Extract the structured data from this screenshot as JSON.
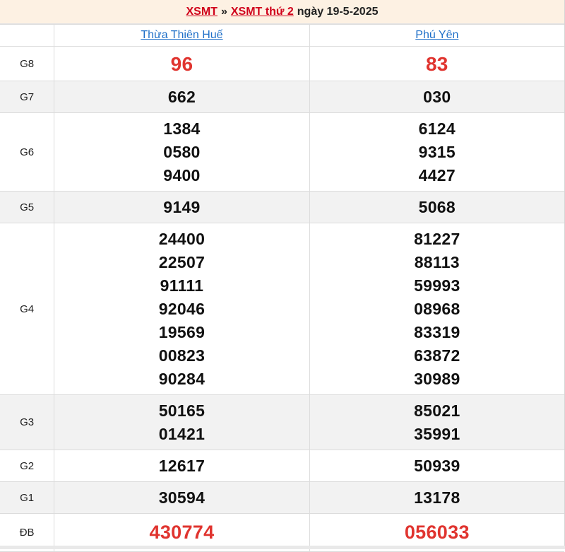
{
  "header": {
    "link1": "XSMT",
    "separator": "»",
    "link2": "XSMT thứ 2",
    "date_text": "ngày 19-5-2025"
  },
  "provinces": [
    "Thừa Thiên Huế",
    "Phú Yên"
  ],
  "prizes": [
    {
      "label": "G8",
      "values": [
        [
          "96"
        ],
        [
          "83"
        ]
      ]
    },
    {
      "label": "G7",
      "values": [
        [
          "662"
        ],
        [
          "030"
        ]
      ]
    },
    {
      "label": "G6",
      "values": [
        [
          "1384",
          "0580",
          "9400"
        ],
        [
          "6124",
          "9315",
          "4427"
        ]
      ]
    },
    {
      "label": "G5",
      "values": [
        [
          "9149"
        ],
        [
          "5068"
        ]
      ]
    },
    {
      "label": "G4",
      "values": [
        [
          "24400",
          "22507",
          "91111",
          "92046",
          "19569",
          "00823",
          "90284"
        ],
        [
          "81227",
          "88113",
          "59993",
          "08968",
          "83319",
          "63872",
          "30989"
        ]
      ]
    },
    {
      "label": "G3",
      "values": [
        [
          "50165",
          "01421"
        ],
        [
          "85021",
          "35991"
        ]
      ]
    },
    {
      "label": "G2",
      "values": [
        [
          "12617"
        ],
        [
          "50939"
        ]
      ]
    },
    {
      "label": "G1",
      "values": [
        [
          "30594"
        ],
        [
          "13178"
        ]
      ]
    },
    {
      "label": "ĐB",
      "values": [
        [
          "430774"
        ],
        [
          "056033"
        ]
      ]
    }
  ],
  "colors": {
    "link_red": "#d0021b",
    "province_link": "#1e6fc8",
    "highlight_number": "#e0342f",
    "header_bg": "#fdf1e3",
    "alt_row_bg": "#f2f2f2"
  }
}
